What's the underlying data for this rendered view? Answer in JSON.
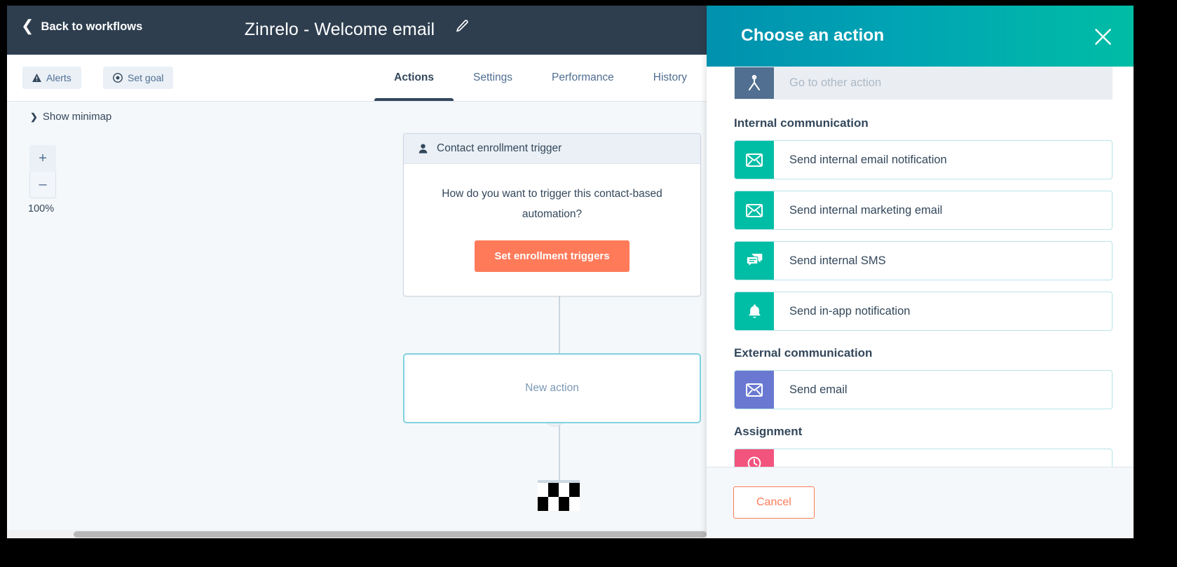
{
  "topbar": {
    "back_label": "Back to workflows",
    "back_icon": "chevron-left-icon",
    "workflow_title": "Zinrelo - Welcome email",
    "edit_icon": "pencil-icon"
  },
  "subnav": {
    "buttons": [
      {
        "label": "Alerts",
        "icon": "warning-triangle-icon"
      },
      {
        "label": "Set goal",
        "icon": "target-icon"
      }
    ],
    "tabs": [
      {
        "label": "Actions",
        "active": true
      },
      {
        "label": "Settings",
        "active": false
      },
      {
        "label": "Performance",
        "active": false
      },
      {
        "label": "History",
        "active": false
      }
    ]
  },
  "canvas": {
    "minimap_toggle": "Show minimap",
    "minimap_chevron_icon": "chevron-right-icon",
    "zoom_in_label": "+",
    "zoom_out_label": "–",
    "zoom_percent": "100%",
    "trigger_card": {
      "header": "Contact enrollment trigger",
      "header_icon": "contact-person-icon",
      "question": "How do you want to trigger this contact-based automation?",
      "cta_label": "Set enrollment triggers",
      "cta_color": "#ff7a59"
    },
    "connector_remove_icon": "close-x-icon",
    "new_action_label": "New action",
    "new_action_border_color": "#7fd1de",
    "end_marker_icon": "checkered-flag-icon"
  },
  "panel": {
    "title": "Choose an action",
    "close_icon": "close-x-icon",
    "header_gradient_from": "#0091ae",
    "header_gradient_to": "#00bda5",
    "top_item": {
      "label": "Go to other action",
      "icon": "branch-icon",
      "icon_color": "#516f90",
      "disabled": true
    },
    "sections": [
      {
        "title": "Internal communication",
        "items": [
          {
            "label": "Send internal email notification",
            "icon": "envelope-icon",
            "icon_color": "#00bda5"
          },
          {
            "label": "Send internal marketing email",
            "icon": "envelope-icon",
            "icon_color": "#00bda5"
          },
          {
            "label": "Send internal SMS",
            "icon": "chat-bubbles-icon",
            "icon_color": "#00bda5"
          },
          {
            "label": "Send in-app notification",
            "icon": "bell-icon",
            "icon_color": "#00bda5"
          }
        ]
      },
      {
        "title": "External communication",
        "items": [
          {
            "label": "Send email",
            "icon": "envelope-icon",
            "icon_color": "#6a78d1"
          }
        ]
      },
      {
        "title": "Assignment",
        "items": [
          {
            "label": "",
            "icon": "rotate-record-icon",
            "icon_color": "#f2547d",
            "clipped": true
          }
        ]
      }
    ],
    "cancel_label": "Cancel",
    "cancel_color": "#ff7a59"
  }
}
